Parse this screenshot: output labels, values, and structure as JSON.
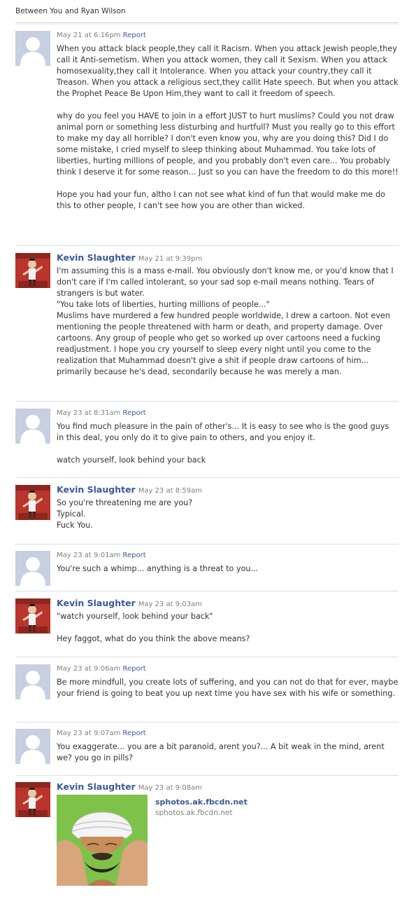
{
  "thread": {
    "title": "Between You and Ryan Wilson"
  },
  "messages": [
    {
      "kind": "anon",
      "name": "",
      "time": "May 21 at 6:16pm",
      "report": "Report",
      "paragraphs": [
        "When you attack black people,they call it Racism. When you attack Jewish people,they call it Anti-semetism. When you attack women, they call it Sexism. When you attack homosexuality,they call it Intolerance. When you attack your country,they call it Treason. When you attack a religious sect,they callit Hate speech. But when you attack the Prophet Peace Be Upon Him,they want to call it freedom of speech.",
        "why do you feel you HAVE to join in a effort JUST to hurt muslims? Could you not draw animal porn or something less disturbing and hurtfull? Must you really go to this effort to make my day all horrible? I don't even know you, why are you doing this? Did I do some mistake, I cried myself to sleep thinking about Muhammad. You take lots of liberties, hurting millions of people, and you probably don't even care... You probably think I deserve it for some reason... Just so you can have the freedom to do this more!!",
        "Hope you had your fun, altho I can not see what kind of fun that would make me do this to other people, I can't see how you are other than wicked."
      ]
    },
    {
      "kind": "kevin",
      "name": "Kevin Slaughter",
      "time": "May 21 at 9:39pm",
      "report": "",
      "paragraphs": [
        "I'm assuming this is a mass e-mail. You obviously don't know me, or you'd know that I don't care if I'm called intolerant, so your sad sop e-mail means nothing. Tears of strangers is but water.\n\"You take lots of liberties, hurting millions of people...\"\nMuslims have murdered a few hundred people worldwide, I drew a cartoon. Not even mentioning the people threatened with harm or death, and property damage. Over cartoons. Any group of people who get so worked up over cartoons need a fucking readjustment. I hope you cry yourself to sleep every night until you come to the realization that Muhammad doesn't give a shit if people draw cartoons of him... primarily because he's dead, secondarily because he was merely a man."
      ]
    },
    {
      "kind": "anon",
      "name": "",
      "time": "May 23 at 8:31am",
      "report": "Report",
      "paragraphs": [
        "You find much pleasure in the pain of other's... It is easy to see who is the good guys in this deal, you only do it to give pain to others, and you enjoy it.",
        "watch yourself, look behind your back"
      ]
    },
    {
      "kind": "kevin",
      "name": "Kevin Slaughter",
      "time": "May 23 at 8:59am",
      "report": "",
      "paragraphs": [
        "So you're threatening me are you?\nTypical.\nFuck You."
      ]
    },
    {
      "kind": "anon",
      "name": "",
      "time": "May 23 at 9:01am",
      "report": "Report",
      "paragraphs": [
        "You're such a whimp... anything is a threat to you..."
      ]
    },
    {
      "kind": "kevin",
      "name": "Kevin Slaughter",
      "time": "May 23 at 9:03am",
      "report": "",
      "paragraphs": [
        "\"watch yourself, look behind your back\"",
        "Hey faggot, what do you think the above means?"
      ]
    },
    {
      "kind": "anon",
      "name": "",
      "time": "May 23 at 9:06am",
      "report": "Report",
      "paragraphs": [
        "Be more mindfull, you create lots of suffering, and you can not do that for ever, maybe your friend is going to beat you up next time you have sex with his wife or something."
      ]
    },
    {
      "kind": "anon",
      "name": "",
      "time": "May 23 at 9:07am",
      "report": "Report",
      "paragraphs": [
        "You exaggerate... you are a bit paranoid, arent you?... A bit weak in the mind, arent we? you go in pills?"
      ]
    },
    {
      "kind": "kevin",
      "name": "Kevin Slaughter",
      "time": "May 23 at 9:08am",
      "report": "",
      "paragraphs": [],
      "attachment": {
        "title": "sphotos.ak.fbcdn.net",
        "subtitle": "sphotos.ak.fbcdn.net"
      }
    }
  ]
}
